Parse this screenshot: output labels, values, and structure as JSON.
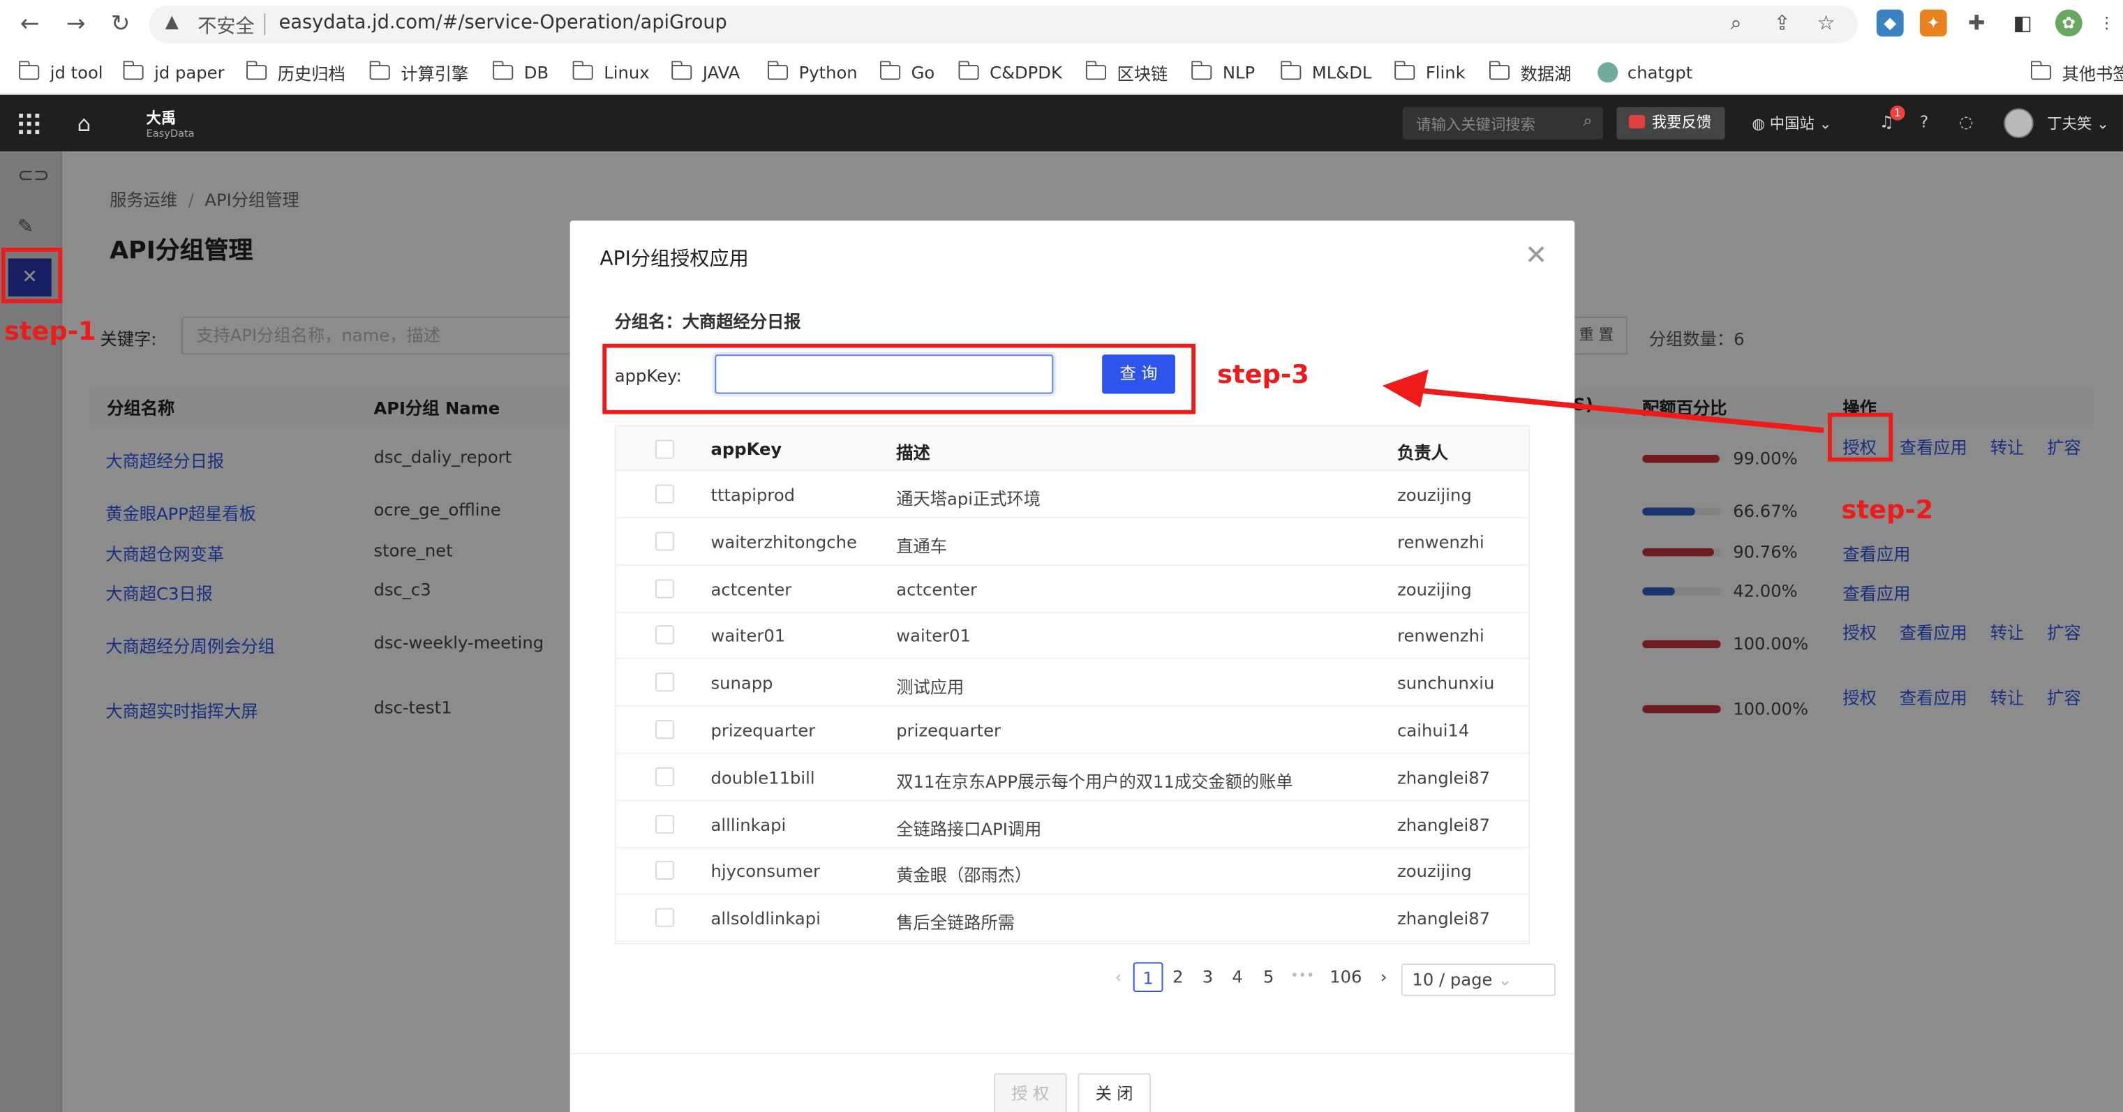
{
  "browser": {
    "insecure_label": "不安全",
    "url": "easydata.jd.com/#/service-Operation/apiGroup",
    "bookmarks": [
      "jd tool",
      "jd paper",
      "历史归档",
      "计算引擎",
      "DB",
      "Linux",
      "JAVA",
      "Python",
      "Go",
      "C&DPDK",
      "区块链",
      "NLP",
      "ML&DL",
      "Flink",
      "数据湖",
      "chatgpt"
    ],
    "other_bookmarks": "其他书签"
  },
  "app": {
    "brand_title": "大禹",
    "brand_subtitle": "EasyData",
    "search_placeholder": "请输入关键词搜索",
    "feedback_label": "我要反馈",
    "region_label": "中国站",
    "notification_count": "1",
    "username": "丁夫笑"
  },
  "page": {
    "breadcrumb": [
      "服务运维",
      "API分组管理"
    ],
    "title": "API分组管理",
    "keyword_label": "关键字:",
    "keyword_placeholder": "支持API分组名称，name，描述",
    "reset_label": "重 置",
    "group_count_label": "分组数量：6",
    "columns": {
      "group_name": "分组名称",
      "api_group_name": "API分组 Name",
      "quota_percent": "配额百分比",
      "operation": "操作",
      "hidden_tail": "S)"
    },
    "rows": [
      {
        "name": "大商超经分日报",
        "code": "dsc_daliy_report",
        "quota": "99.00%",
        "quota_value": 99.0,
        "bar_color": "#c8343a",
        "ops": [
          "授权",
          "查看应用",
          "转让",
          "扩容"
        ]
      },
      {
        "name": "黄金眼APP超星看板",
        "code": "ocre_ge_offline",
        "quota": "66.67%",
        "quota_value": 66.67,
        "bar_color": "#2f62c8",
        "ops": []
      },
      {
        "name": "大商超仓网变革",
        "code": "store_net",
        "quota": "90.76%",
        "quota_value": 90.76,
        "bar_color": "#c8343a",
        "ops": [
          "查看应用"
        ]
      },
      {
        "name": "大商超C3日报",
        "code": "dsc_c3",
        "quota": "42.00%",
        "quota_value": 42.0,
        "bar_color": "#2f62c8",
        "ops": [
          "查看应用"
        ]
      },
      {
        "name": "大商超经分周例会分组",
        "code": "dsc-weekly-meeting",
        "quota": "100.00%",
        "quota_value": 100.0,
        "bar_color": "#c8343a",
        "ops": [
          "授权",
          "查看应用",
          "转让",
          "扩容"
        ]
      },
      {
        "name": "大商超实时指挥大屏",
        "code": "dsc-test1",
        "quota": "100.00%",
        "quota_value": 100.0,
        "bar_color": "#c8343a",
        "ops": [
          "授权",
          "查看应用",
          "转让",
          "扩容"
        ]
      }
    ]
  },
  "modal": {
    "title": "API分组授权应用",
    "group_line": "分组名：大商超经分日报",
    "appkey_label": "appKey:",
    "appkey_value": "",
    "query_label": "查 询",
    "columns": {
      "appkey": "appKey",
      "desc": "描述",
      "owner": "负责人"
    },
    "apps": [
      {
        "appKey": "tttapiprod",
        "desc": "通天塔api正式环境",
        "owner": "zouzijing"
      },
      {
        "appKey": "waiterzhitongche",
        "desc": "直通车",
        "owner": "renwenzhi"
      },
      {
        "appKey": "actcenter",
        "desc": "actcenter",
        "owner": "zouzijing"
      },
      {
        "appKey": "waiter01",
        "desc": "waiter01",
        "owner": "renwenzhi"
      },
      {
        "appKey": "sunapp",
        "desc": "测试应用",
        "owner": "sunchunxiu"
      },
      {
        "appKey": "prizequarter",
        "desc": "prizequarter",
        "owner": "caihui14"
      },
      {
        "appKey": "double11bill",
        "desc": "双11在京东APP展示每个用户的双11成交金额的账单",
        "owner": "zhanglei87"
      },
      {
        "appKey": "alllinkapi",
        "desc": "全链路接口API调用",
        "owner": "zhanglei87"
      },
      {
        "appKey": "hjyconsumer",
        "desc": "黄金眼（邵雨杰）",
        "owner": "zouzijing"
      },
      {
        "appKey": "allsoldlinkapi",
        "desc": "售后全链路所需",
        "owner": "zhanglei87"
      }
    ],
    "pagination": {
      "pages": [
        "1",
        "2",
        "3",
        "4",
        "5"
      ],
      "ellipsis": "•••",
      "last_page": "106",
      "current": "1",
      "page_size": "10 / page"
    },
    "auth_label": "授 权",
    "close_label": "关 闭"
  },
  "annotations": {
    "step1": "step-1",
    "step2": "step-2",
    "step3": "step-3",
    "color": "#ee1b1b"
  }
}
